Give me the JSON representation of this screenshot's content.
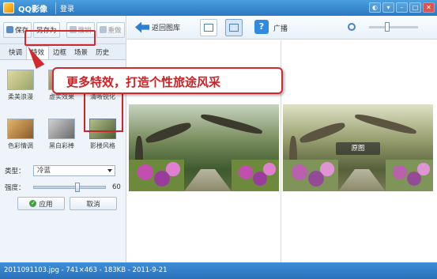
{
  "titlebar": {
    "app_title": "QQ影像",
    "login": "登录",
    "window_buttons": [
      "◐",
      "▾",
      "–",
      "□",
      "✕"
    ]
  },
  "left_toolbar": {
    "save": "保存",
    "save_as": "另存为",
    "undo": "撤销",
    "redo": "重做"
  },
  "tabs": [
    "快调",
    "特效",
    "边框",
    "场景",
    "历史"
  ],
  "effects": [
    {
      "label": "柔美浪漫",
      "color": "#c9c27e"
    },
    {
      "label": "虚实效果",
      "color": "#9b8f6a"
    },
    {
      "label": "清晰锐化",
      "color": "#8c7f5a"
    },
    {
      "label": "色彩情调",
      "color": "#b8843a"
    },
    {
      "label": "黑白彩棒",
      "color": "#9a9a9a"
    },
    {
      "label": "影楼风格",
      "color": "#7b8c5a"
    }
  ],
  "controls": {
    "type_label": "类型：",
    "type_value": "冷蓝",
    "strength_label": "强度：",
    "strength_value": "60",
    "strength_fraction": 0.6,
    "apply": "应用",
    "cancel": "取消"
  },
  "main_toolbar": {
    "back": "返回图库",
    "ad": "广播"
  },
  "photo_overlay": "原图",
  "callout": "更多特效，打造个性旅途风采",
  "status": "2011091103.jpg - 741×463 - 183KB - 2011-9-21"
}
